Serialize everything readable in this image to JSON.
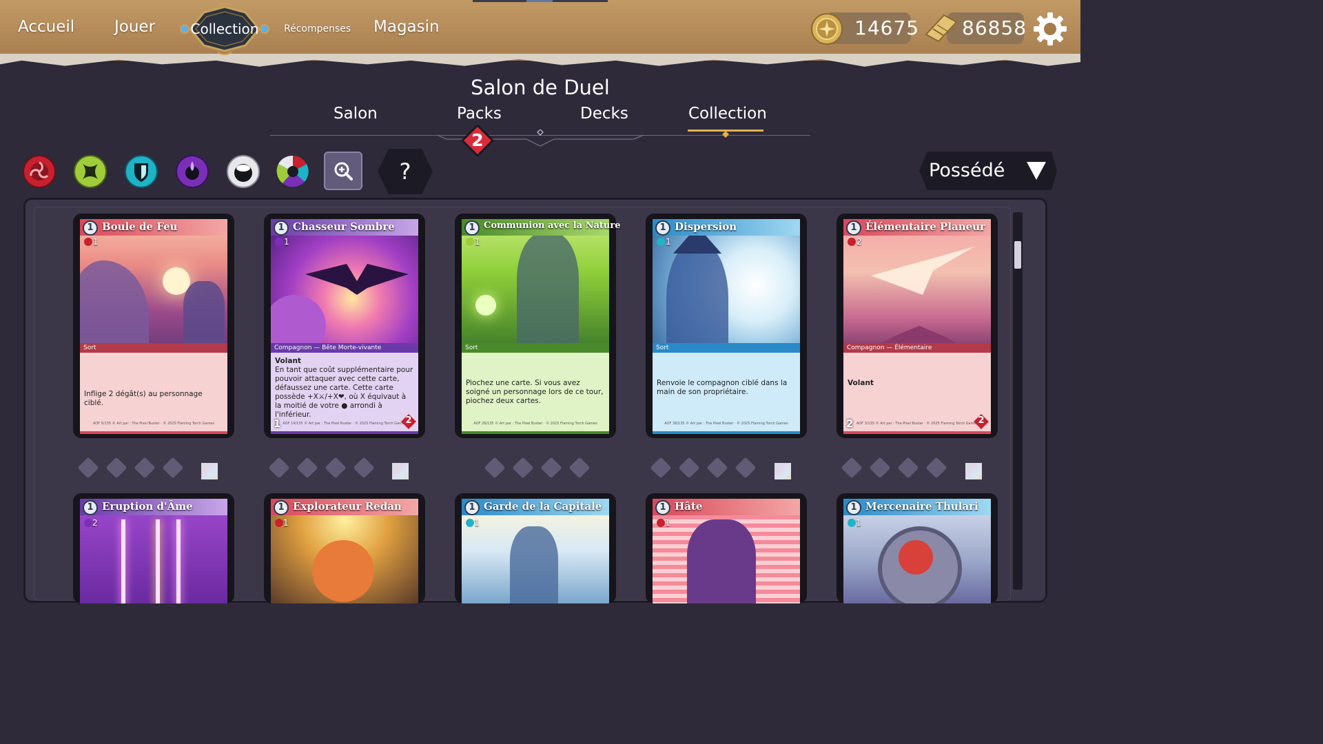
{
  "topnav": {
    "accueil": "Accueil",
    "jouer": "Jouer",
    "collection": "Collection",
    "recompenses": "Récompenses",
    "magasin": "Magasin"
  },
  "currency": {
    "gold": "14675",
    "tickets": "86858"
  },
  "header": {
    "title": "Salon de Duel",
    "tabs": {
      "salon": "Salon",
      "packs": "Packs",
      "decks": "Decks",
      "collection": "Collection"
    },
    "packs_badge": "2",
    "active_tab": "Collection"
  },
  "filters": {
    "colors": [
      "red",
      "green",
      "cyan",
      "purple",
      "white",
      "multicolor"
    ],
    "help": "?",
    "owned_select": "Possédé"
  },
  "cards_row1": [
    {
      "name": "Boule de Feu",
      "cost": "1",
      "stat": "1",
      "type": "Sort",
      "text": "Inflige 2 dégât(s) au personnage ciblé.",
      "footer": "AOF 5/135 © Art par : The Pixel Buster · © 2025 Flaming Torch Games",
      "color": "red"
    },
    {
      "name": "Chasseur Sombre",
      "cost": "1",
      "stat": "1",
      "type": "Compagnon — Bête Morte-vivante",
      "keyword": "Volant",
      "text": "En tant que coût supplémentaire pour pouvoir attaquer avec cette carte, défaussez une carte. Cette carte possède +X⚔/+X❤, où X équivaut à la moitié de votre ● arrondi à l'inférieur.",
      "attack": "1",
      "health": "2",
      "footer": "AOF 14/135 © Art par : The Pixel Buster · © 2025 Flaming Torch Games",
      "color": "purple"
    },
    {
      "name": "Communion avec la Nature",
      "cost": "1",
      "stat": "1",
      "type": "Sort",
      "text": "Piochez une carte. Si vous avez soigné un personnage lors de ce tour, piochez deux cartes.",
      "footer": "AOF 26/135 © Art par : The Pixel Buster · © 2025 Flaming Torch Games",
      "color": "green"
    },
    {
      "name": "Dispersion",
      "cost": "1",
      "stat": "1",
      "type": "Sort",
      "text": "Renvoie le compagnon ciblé dans la main de son propriétaire.",
      "footer": "AOF 36/135 © Art par : The Pixel Buster · © 2025 Flaming Torch Games",
      "color": "blue"
    },
    {
      "name": "Élémentaire Planeur",
      "cost": "1",
      "stat": "2",
      "type": "Compagnon — Élémentaire",
      "keyword": "Volant",
      "text": "",
      "attack": "2",
      "health": "2",
      "footer": "AOF 3/135 © Art par : The Pixel Buster · © 2025 Flaming Torch Games",
      "color": "red"
    }
  ],
  "cards_row2": [
    {
      "name": "Eruption d'Âme",
      "cost": "1",
      "stat": "2",
      "color": "purple"
    },
    {
      "name": "Explorateur Redan",
      "cost": "1",
      "stat": "1",
      "color": "red"
    },
    {
      "name": "Garde de la Capitale",
      "cost": "1",
      "stat": "1",
      "color": "blue"
    },
    {
      "name": "Hâte",
      "cost": "1",
      "stat": "1",
      "color": "red"
    },
    {
      "name": "Mercenaire Thulari",
      "cost": "1",
      "stat": "1",
      "color": "blue"
    }
  ]
}
